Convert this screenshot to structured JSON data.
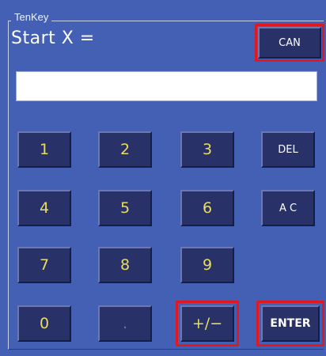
{
  "group": {
    "title": "TenKey"
  },
  "prompt": {
    "label": "Start X ="
  },
  "display": {
    "value": ""
  },
  "buttons": {
    "can": "CAN",
    "d1": "1",
    "d2": "2",
    "d3": "3",
    "del": "DEL",
    "d4": "4",
    "d5": "5",
    "d6": "6",
    "ac": "A C",
    "d7": "7",
    "d8": "8",
    "d9": "9",
    "d0": "0",
    "dot": ".",
    "sign": "+/−",
    "enter": "ENTER"
  },
  "colors": {
    "panel": "#4460b4",
    "key": "#283268",
    "digit_text": "#e8dc64",
    "highlight": "#e01820"
  }
}
